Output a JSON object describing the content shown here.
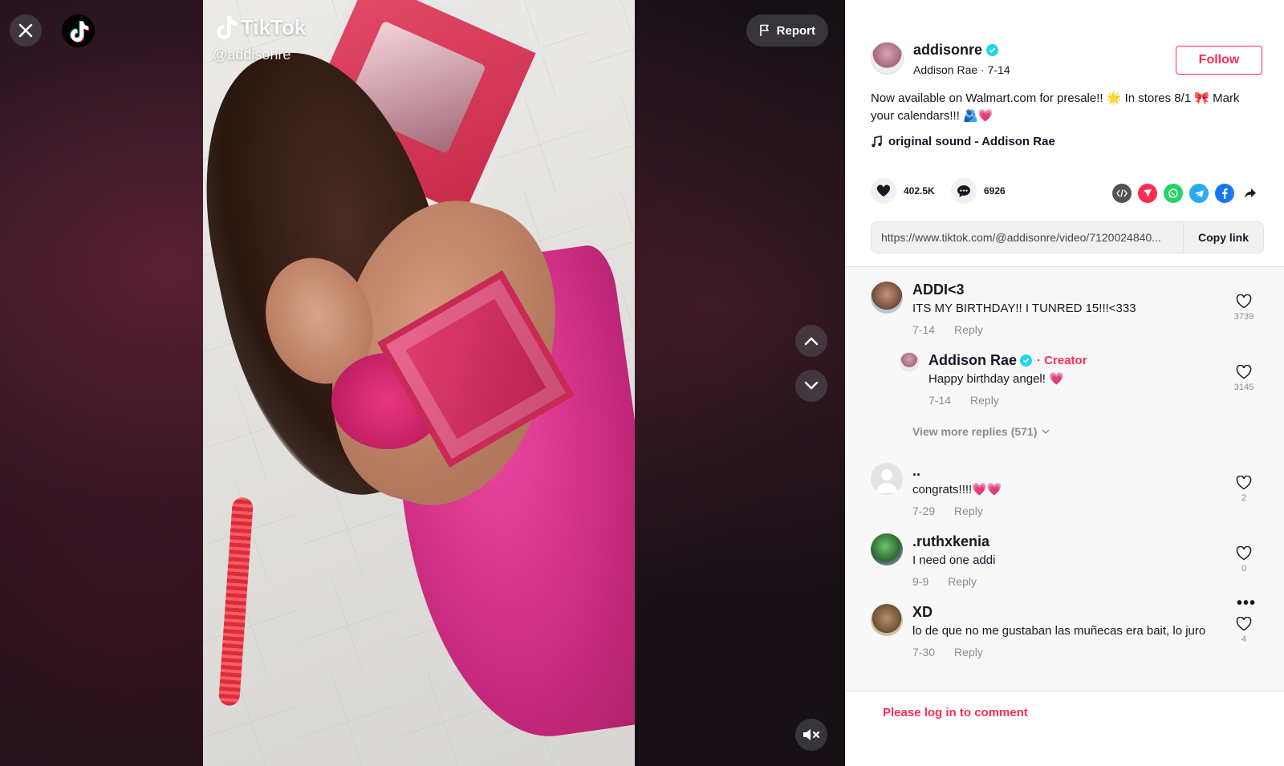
{
  "video": {
    "watermark_brand": "TikTok",
    "watermark_handle": "@addisonre",
    "report_label": "Report"
  },
  "author": {
    "username": "addisonre",
    "display_name": "Addison Rae",
    "date": "7-14",
    "subline": "Addison Rae · 7-14",
    "follow_label": "Follow",
    "caption": "Now available on Walmart.com for presale!! 🌟 In stores 8/1 🎀 Mark your calendars!!! 🫂💗",
    "sound": "original sound - Addison Rae"
  },
  "stats": {
    "likes": "402.5K",
    "comments": "6926"
  },
  "share_icons": [
    "embed-icon",
    "send-icon",
    "whatsapp-icon",
    "telegram-icon",
    "facebook-icon",
    "share-arrow-icon"
  ],
  "link": {
    "url": "https://www.tiktok.com/@addisonre/video/7120024840...",
    "copy_label": "Copy link"
  },
  "comments": [
    {
      "user": "ADDI<3",
      "text": "ITS MY BIRTHDAY!! I TUNRED 15!!!<333",
      "date": "7-14",
      "reply": "Reply",
      "likes": "3739"
    },
    {
      "user": "Addison Rae",
      "creator_tag": "· Creator",
      "text": "Happy birthday angel! 💗",
      "date": "7-14",
      "reply": "Reply",
      "likes": "3145"
    },
    {
      "user": "..",
      "text": "congrats!!!!💗💗",
      "date": "7-29",
      "reply": "Reply",
      "likes": "2"
    },
    {
      "user": ".ruthxkenia",
      "text": "I need one addi",
      "date": "9-9",
      "reply": "Reply",
      "likes": "0"
    },
    {
      "user": "XD",
      "text": "lo de que no me gustaban las muñecas era bait, lo juro",
      "date": "7-30",
      "reply": "Reply",
      "likes": "4"
    }
  ],
  "view_more_replies": "View more replies (571)",
  "login_prompt": "Please log in to comment",
  "colors": {
    "accent": "#fe2c55",
    "verified": "#20d5ec"
  }
}
